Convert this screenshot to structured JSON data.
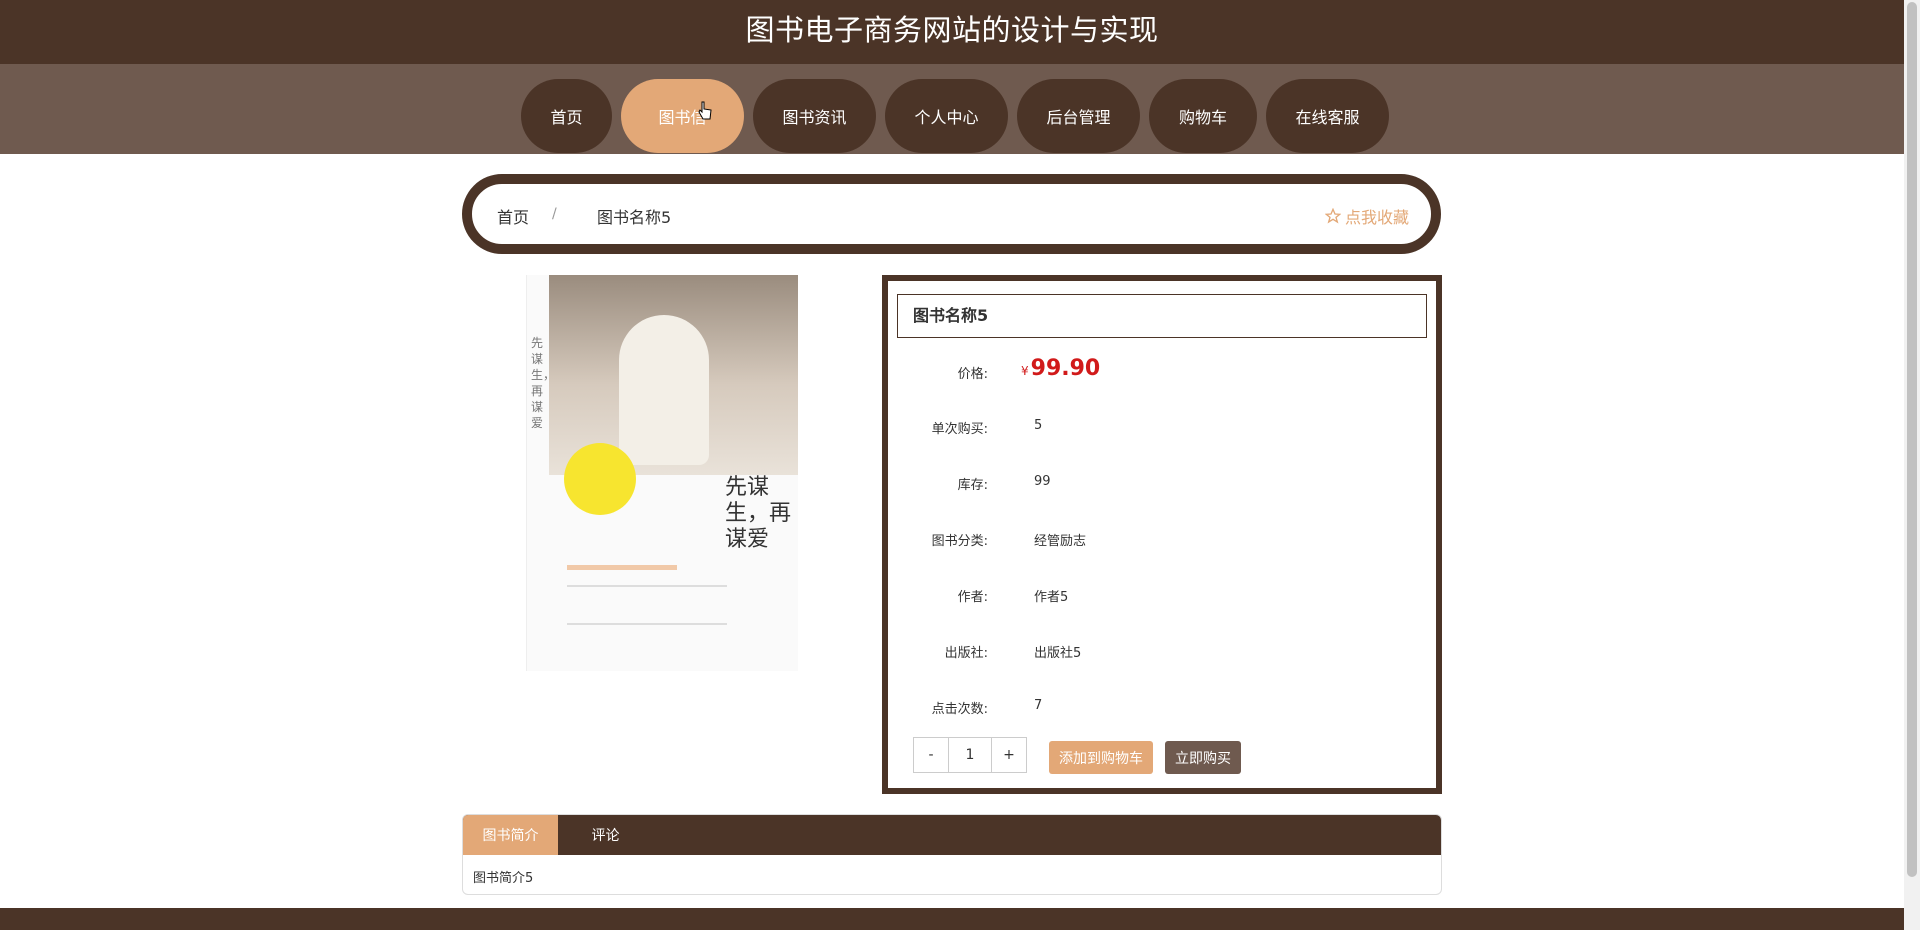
{
  "site": {
    "title": "图书电子商务网站的设计与实现"
  },
  "nav": {
    "items": [
      {
        "label": "首页",
        "active": false
      },
      {
        "label": "图书信",
        "active": true
      },
      {
        "label": "图书资讯",
        "active": false
      },
      {
        "label": "个人中心",
        "active": false
      },
      {
        "label": "后台管理",
        "active": false
      },
      {
        "label": "购物车",
        "active": false
      },
      {
        "label": "在线客服",
        "active": false
      }
    ]
  },
  "breadcrumb": {
    "home": "首页",
    "separator": "/",
    "current": "图书名称5",
    "favorite": "点我收藏",
    "favorite_icon": "star-outline-icon"
  },
  "cover": {
    "spine_text": "先谋生，再谋爱",
    "title_text": "先谋生，再谋爱"
  },
  "book": {
    "name": "图书名称5",
    "price_label": "价格:",
    "currency": "¥",
    "price": "99.90",
    "fields": [
      {
        "label": "单次购买:",
        "value": "5"
      },
      {
        "label": "库存:",
        "value": "99"
      },
      {
        "label": "图书分类:",
        "value": "经管励志"
      },
      {
        "label": "作者:",
        "value": "作者5"
      },
      {
        "label": "出版社:",
        "value": "出版社5"
      },
      {
        "label": "点击次数:",
        "value": "7"
      }
    ]
  },
  "actions": {
    "minus": "-",
    "quantity": "1",
    "plus": "+",
    "add_to_cart": "添加到购物车",
    "buy_now": "立即购买"
  },
  "tabs": {
    "items": [
      {
        "label": "图书简介",
        "active": true
      },
      {
        "label": "评论",
        "active": false
      }
    ],
    "content": "图书简介5"
  },
  "colors": {
    "primary": "#4b3427",
    "accent": "#e3a877",
    "nav_bg": "#6f5a4f",
    "price": "#d11a1a"
  }
}
